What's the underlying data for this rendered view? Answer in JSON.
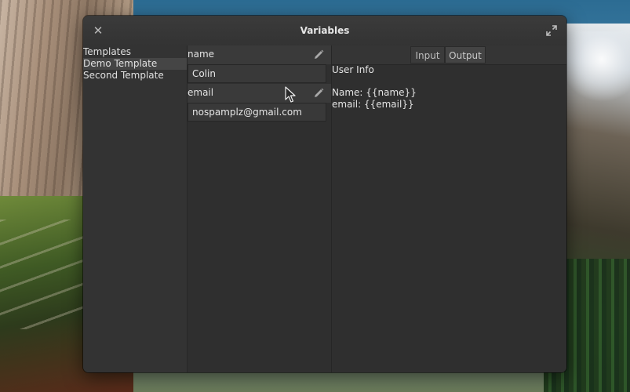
{
  "window": {
    "title": "Variables"
  },
  "sidebar": {
    "items": [
      {
        "label": "Templates",
        "selected": false
      },
      {
        "label": "Demo Template",
        "selected": true
      },
      {
        "label": "Second Template",
        "selected": false
      }
    ]
  },
  "variables": [
    {
      "name": "name",
      "value": "Colin"
    },
    {
      "name": "email",
      "value": "nospamplz@gmail.com"
    }
  ],
  "panel": {
    "tabs": [
      {
        "label": "Input",
        "active": false
      },
      {
        "label": "Output",
        "active": true
      }
    ],
    "lines": [
      "User Info",
      "",
      "Name: {{name}}",
      "email: {{email}}"
    ]
  },
  "icons": {
    "close": "close-icon",
    "maximize": "maximize-icon",
    "edit": "pencil-icon",
    "cursor": "mouse-pointer-icon"
  },
  "colors": {
    "window_bg": "#2f2f2f",
    "sidebar_bg": "#333333",
    "selected_bg": "#454545",
    "text": "#e2e2e2"
  }
}
